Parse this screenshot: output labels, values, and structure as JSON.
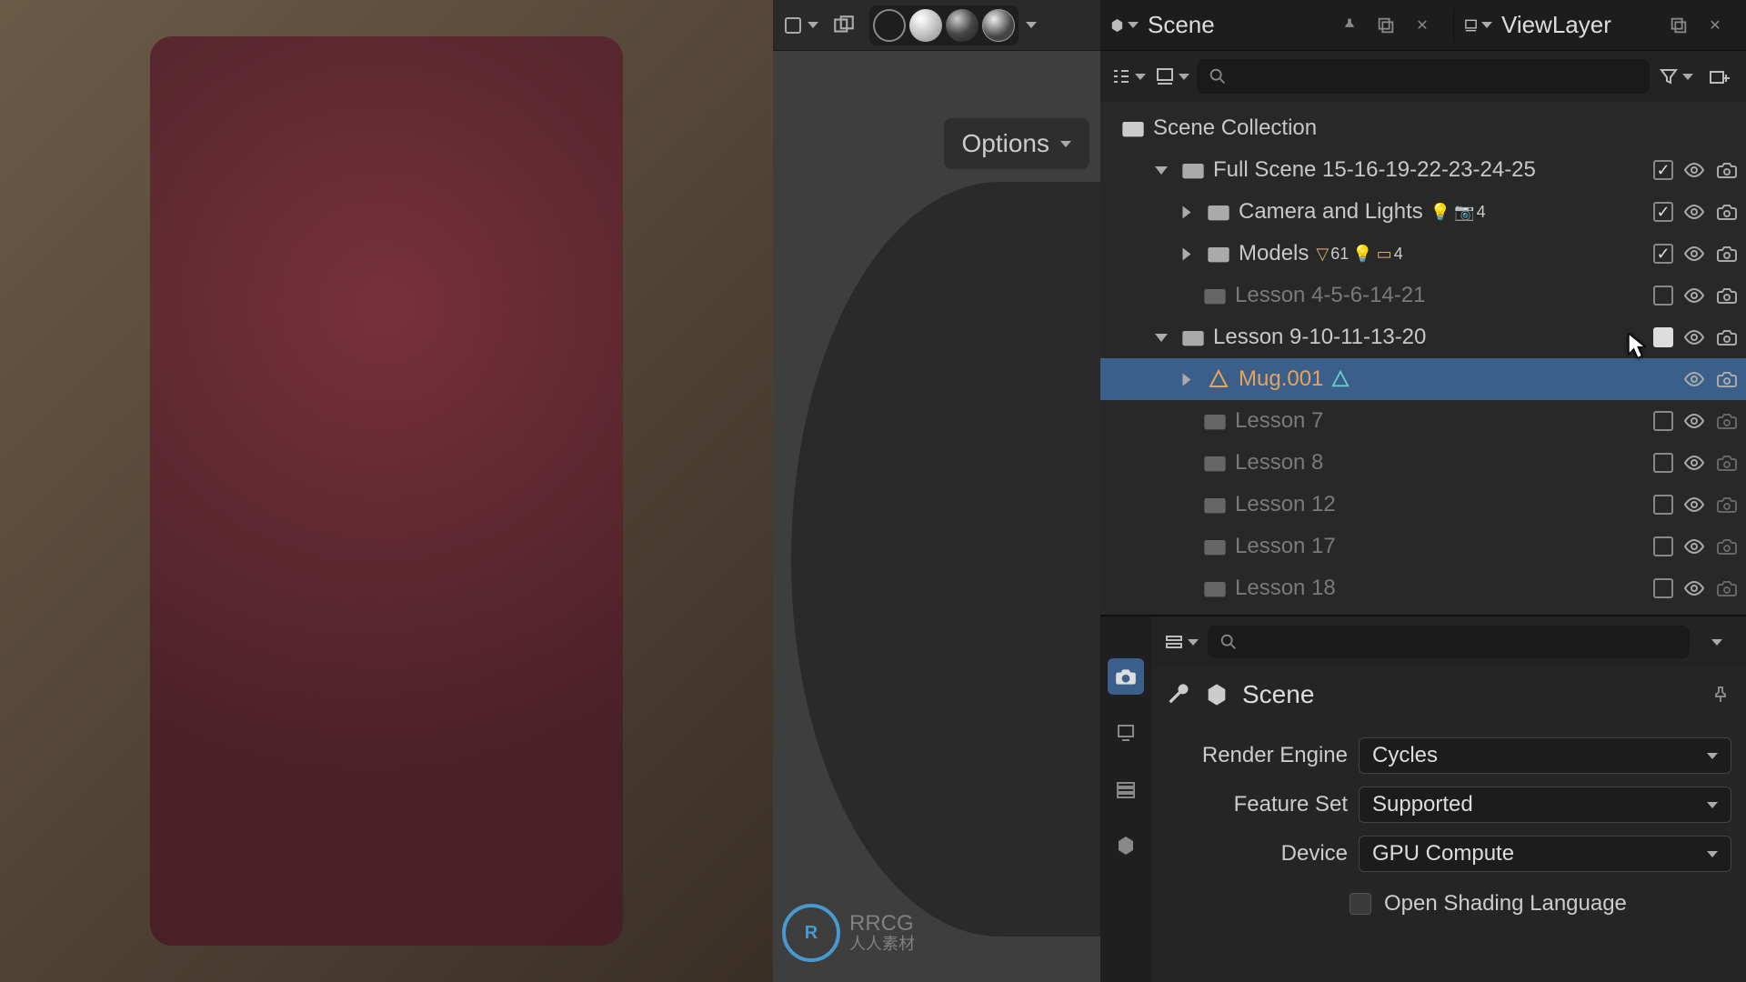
{
  "scene_selector": {
    "scene": "Scene",
    "viewlayer": "ViewLayer"
  },
  "viewport": {
    "options_label": "Options"
  },
  "outliner": {
    "root": "Scene Collection",
    "rows": [
      {
        "name": "Full Scene 15-16-19-22-23-24-25",
        "depth": 1,
        "expanded": true,
        "kind": "collection",
        "enabled": true,
        "visible": true,
        "render": true,
        "dim": false
      },
      {
        "name": "Camera and Lights",
        "depth": 2,
        "expanded": false,
        "kind": "collection",
        "enabled": true,
        "visible": true,
        "render": true,
        "dim": false,
        "badges": [
          "light",
          "camera-4"
        ]
      },
      {
        "name": "Models",
        "depth": 2,
        "expanded": false,
        "kind": "collection",
        "enabled": true,
        "visible": true,
        "render": true,
        "dim": false,
        "badges": [
          "mesh-61",
          "light",
          "coll-4"
        ]
      },
      {
        "name": "Lesson 4-5-6-14-21",
        "depth": 2,
        "expanded": false,
        "kind": "collection",
        "enabled": false,
        "visible": true,
        "render": true,
        "dim": true,
        "no_disc": true
      },
      {
        "name": "Lesson 9-10-11-13-20",
        "depth": 1,
        "expanded": true,
        "kind": "collection",
        "enabled": true,
        "visible": true,
        "render": true,
        "dim": false,
        "enabled_box_highlight": true
      },
      {
        "name": "Mug.001",
        "depth": 2,
        "expanded": false,
        "kind": "mesh",
        "selected": true,
        "visible": true,
        "render": true
      },
      {
        "name": "Lesson 7",
        "depth": 2,
        "expanded": false,
        "kind": "collection",
        "enabled": false,
        "visible": true,
        "render": false,
        "dim": true,
        "no_disc": true
      },
      {
        "name": "Lesson 8",
        "depth": 2,
        "expanded": false,
        "kind": "collection",
        "enabled": false,
        "visible": true,
        "render": false,
        "dim": true,
        "no_disc": true
      },
      {
        "name": "Lesson 12",
        "depth": 2,
        "expanded": false,
        "kind": "collection",
        "enabled": false,
        "visible": true,
        "render": false,
        "dim": true,
        "no_disc": true
      },
      {
        "name": "Lesson 17",
        "depth": 2,
        "expanded": false,
        "kind": "collection",
        "enabled": false,
        "visible": true,
        "render": false,
        "dim": true,
        "no_disc": true
      },
      {
        "name": "Lesson 18",
        "depth": 2,
        "expanded": false,
        "kind": "collection",
        "enabled": false,
        "visible": true,
        "render": false,
        "dim": true,
        "no_disc": true
      }
    ]
  },
  "properties": {
    "breadcrumb": "Scene",
    "rows": [
      {
        "label": "Render Engine",
        "value": "Cycles"
      },
      {
        "label": "Feature Set",
        "value": "Supported"
      },
      {
        "label": "Device",
        "value": "GPU Compute"
      }
    ],
    "osl_label": "Open Shading Language"
  },
  "watermark": {
    "line1": "RRCG",
    "line2": "人人素材"
  }
}
